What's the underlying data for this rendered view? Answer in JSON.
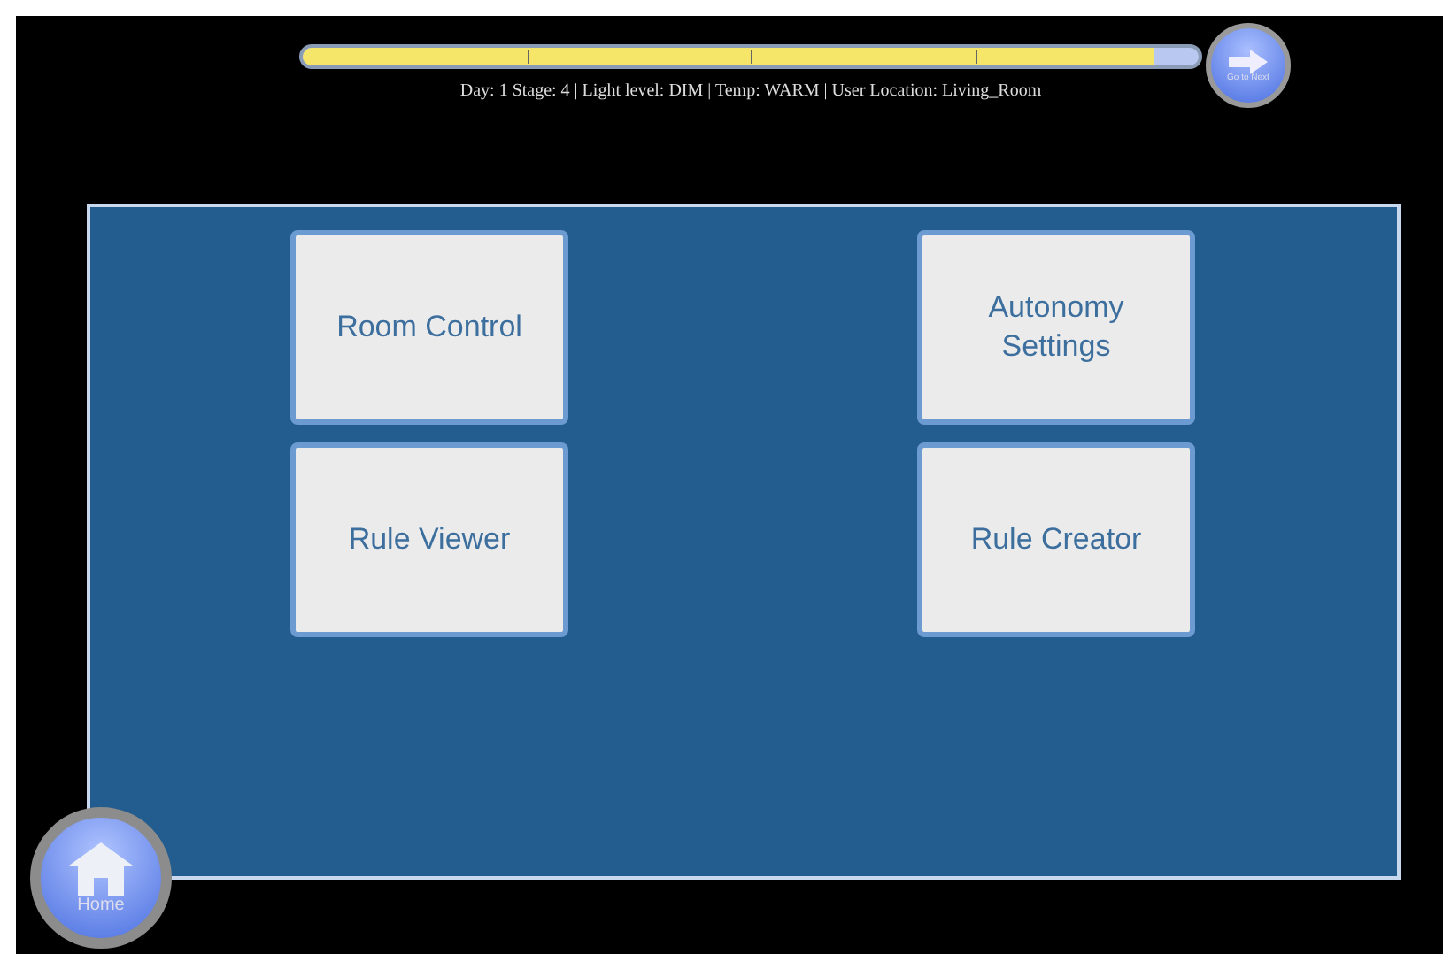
{
  "progress": {
    "level": 0.95,
    "status": "Day: 1 Stage: 4 | Light level: DIM | Temp: WARM | User Location: Living_Room"
  },
  "next_button": {
    "label": "Go to Next"
  },
  "menu_rows": [
    {
      "buttons": [
        {
          "label": "Room Control"
        },
        {
          "label": "Autonomy Settings"
        }
      ]
    },
    {
      "buttons": [
        {
          "label": "Rule Viewer"
        },
        {
          "label": "Rule Creator"
        }
      ]
    }
  ],
  "home_button": {
    "label": "Home"
  }
}
